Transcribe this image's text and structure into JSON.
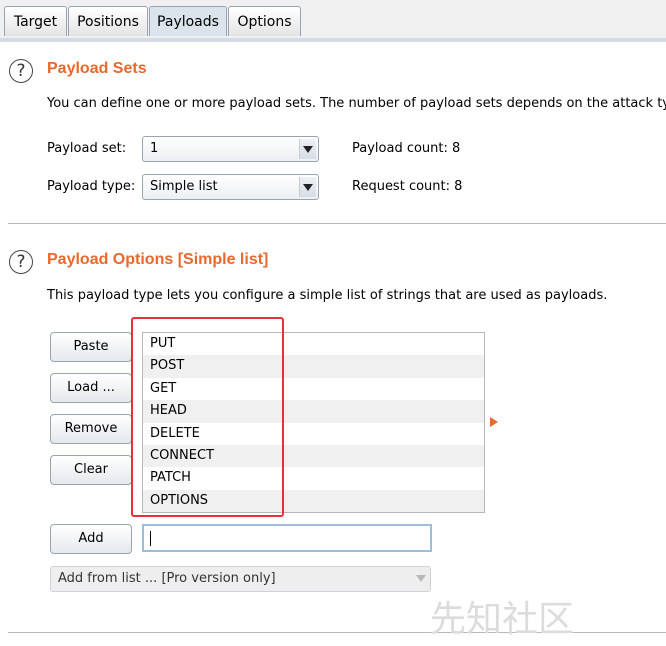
{
  "tabs": [
    "Target",
    "Positions",
    "Payloads",
    "Options"
  ],
  "active_tab": "Payloads",
  "payload_sets": {
    "title": "Payload Sets",
    "description": "You can define one or more payload sets. The number of payload sets depends on the attack type",
    "set_label": "Payload set:",
    "set_value": "1",
    "type_label": "Payload type:",
    "type_value": "Simple list",
    "payload_count": "Payload count:  8",
    "request_count": "Request count:  8"
  },
  "payload_options": {
    "title": "Payload Options [Simple list]",
    "description": "This payload type lets you configure a simple list of strings that are used as payloads.",
    "buttons": {
      "paste": "Paste",
      "load": "Load ...",
      "remove": "Remove",
      "clear": "Clear",
      "add": "Add"
    },
    "items": [
      "PUT",
      "POST",
      "GET",
      "HEAD",
      "DELETE",
      "CONNECT",
      "PATCH",
      "OPTIONS"
    ],
    "add_input_value": "",
    "add_from_list": "Add from list ... [Pro version only]"
  },
  "icons": {
    "help": "help-circle-icon",
    "dropdown": "chevron-down-icon",
    "expand": "play-arrow-icon"
  },
  "colors": {
    "section_title": "#e8692b",
    "highlight_box": "#e8303a"
  },
  "watermark": "先知社区"
}
